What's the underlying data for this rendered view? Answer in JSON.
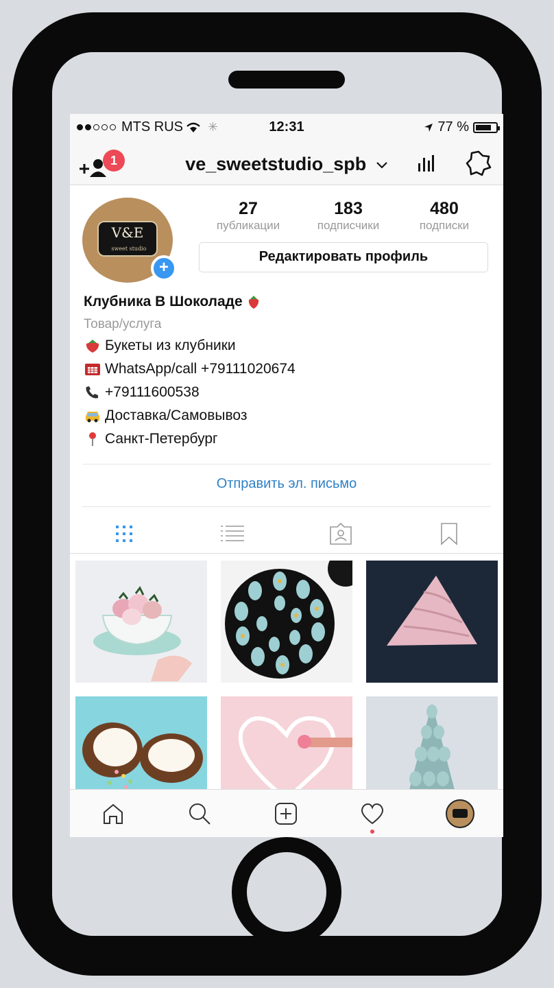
{
  "status_bar": {
    "carrier": "MTS RUS",
    "time": "12:31",
    "battery": "77 %",
    "battery_level": 0.77
  },
  "header": {
    "notification_count": "1",
    "username": "ve_sweetstudio_spb",
    "add_user_icon": "add-user-icon",
    "dropdown_icon": "chevron-down-icon",
    "insights_icon": "bar-chart-icon",
    "settings_icon": "gear-icon"
  },
  "profile": {
    "avatar_text": "V&E",
    "avatar_subtext": "sweet studio",
    "stats": [
      {
        "count": "27",
        "label": "публикации"
      },
      {
        "count": "183",
        "label": "подписчики"
      },
      {
        "count": "480",
        "label": "подписки"
      }
    ],
    "edit_button": "Редактировать профиль",
    "name": "Клубника В Шоколаде",
    "category": "Товар/услуга",
    "bio": [
      {
        "icon": "strawberry-icon",
        "text": "Букеты из клубники"
      },
      {
        "icon": "telephone-icon",
        "text": "WhatsApp/call +79111020674"
      },
      {
        "icon": "phone-receiver-icon",
        "text": "+79111600538"
      },
      {
        "icon": "taxi-icon",
        "text": "Доставка/Самовывоз"
      },
      {
        "icon": "pin-icon",
        "text": "Санкт-Петербург"
      }
    ],
    "email_button": "Отправить эл. письмо"
  },
  "tabs": [
    "grid-view-icon",
    "list-view-icon",
    "tagged-icon",
    "saved-icon"
  ],
  "posts": [
    "strawberries-in-teacup",
    "chocolate-strawberry-platter",
    "pink-meringue-pyramid",
    "coconut-with-sprinkles",
    "neon-heart",
    "blue-meringue-tower"
  ],
  "bottom_nav": [
    "home-icon",
    "search-icon",
    "new-post-icon",
    "activity-icon",
    "profile-avatar-icon"
  ],
  "colors": {
    "accent_blue": "#3897f0",
    "link_blue": "#2f81c4",
    "badge_red": "#ed4956",
    "phone_frame": "#0a0a0a",
    "background": "#d9dce1"
  }
}
